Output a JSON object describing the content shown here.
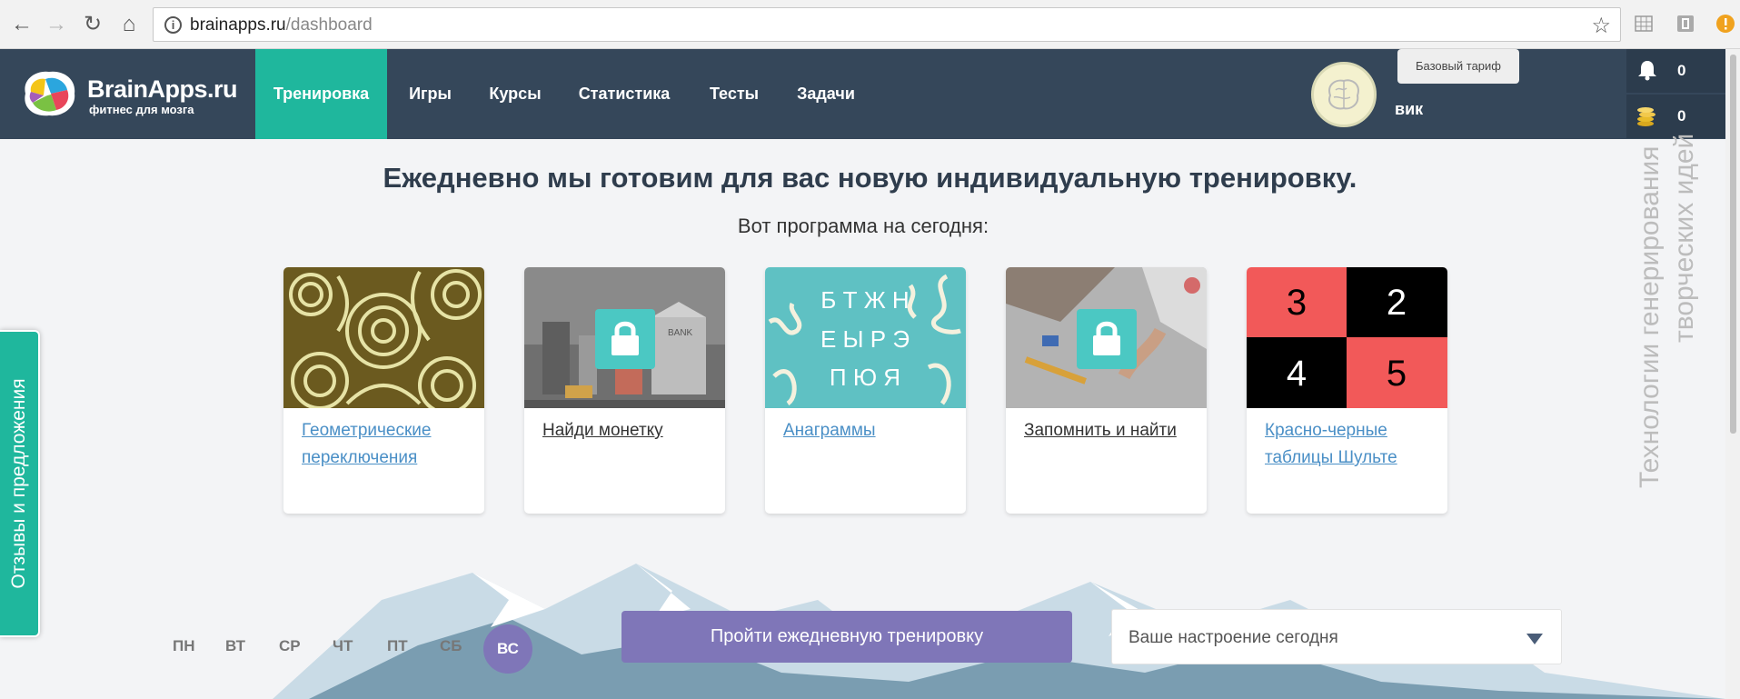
{
  "browser": {
    "url_host": "brainapps.ru",
    "url_path": "/dashboard"
  },
  "header": {
    "logo_title": "BrainApps.ru",
    "logo_subtitle": "фитнес для мозга",
    "menu": [
      {
        "label": "Тренировка",
        "active": true
      },
      {
        "label": "Игры",
        "active": false
      },
      {
        "label": "Курсы",
        "active": false
      },
      {
        "label": "Статистика",
        "active": false
      },
      {
        "label": "Тесты",
        "active": false
      },
      {
        "label": "Задачи",
        "active": false
      }
    ],
    "tariff": "Базовый тариф",
    "username": "вик",
    "notifications_count": "0",
    "coins_count": "0",
    "accent_color": "#1fb79d",
    "bg_color": "#35475a"
  },
  "main": {
    "headline": "Ежедневно мы готовим для вас новую индивидуальную тренировку.",
    "subline": "Вот программа на сегодня:",
    "cards": [
      {
        "title": "Геометрические переключения",
        "locked": false,
        "link_color": "#4a8fc6"
      },
      {
        "title": "Найди монетку",
        "locked": true,
        "link_color": "#333333"
      },
      {
        "title": "Анаграммы",
        "locked": false,
        "link_color": "#4a8fc6"
      },
      {
        "title": "Запомнить и найти",
        "locked": true,
        "link_color": "#333333"
      },
      {
        "title": "Красно-черные таблицы Шульте",
        "locked": false,
        "link_color": "#4a8fc6"
      }
    ],
    "anagram_rows": [
      "Б Т Ж Н",
      "Е Ы Р Э",
      "П Ю Я"
    ],
    "schulte_numbers": [
      "3",
      "2",
      "4",
      "5"
    ]
  },
  "sidebar": {
    "feedback_label": "Отзывы и предложения"
  },
  "watermark": {
    "line1": "Технологии генерирования",
    "line2": "творческих идей"
  },
  "footer": {
    "days": [
      "ПН",
      "ВТ",
      "СР",
      "ЧТ",
      "ПТ",
      "СБ"
    ],
    "active_day": "ВС",
    "train_button": "Пройти ежедневную тренировку",
    "mood_placeholder": "Ваше настроение сегодня",
    "button_color": "#7f76b8"
  }
}
